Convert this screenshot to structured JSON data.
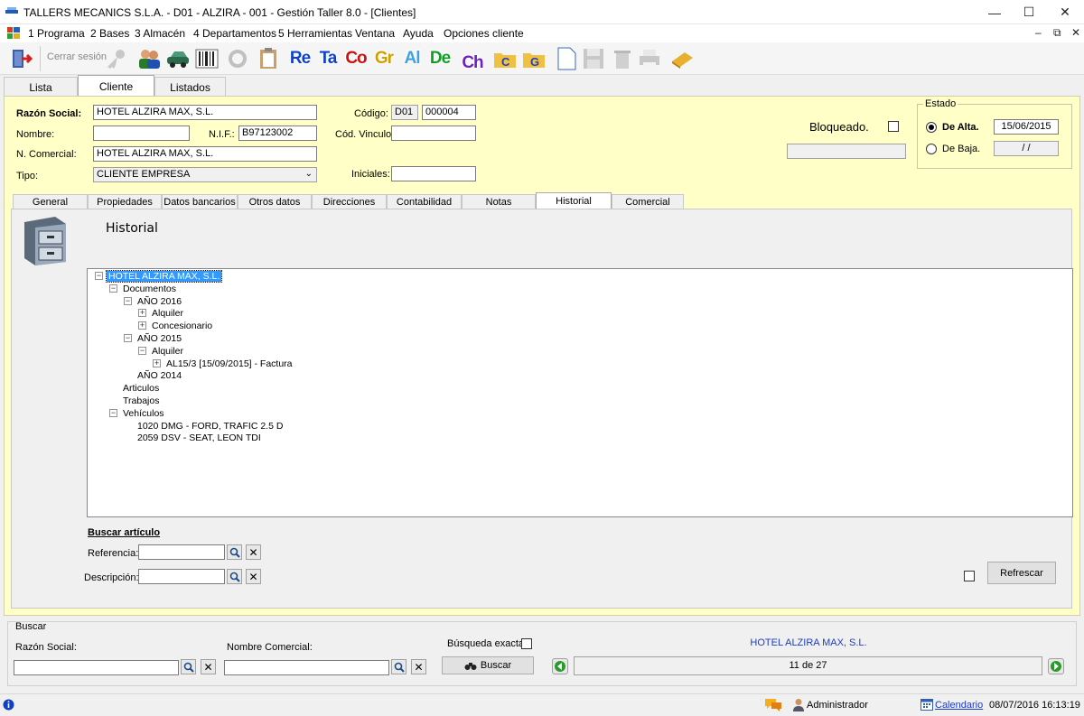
{
  "window": {
    "title": "TALLERS MECANICS S.L.A. - D01 - ALZIRA - 001 - Gestión Taller 8.0 - [Clientes]"
  },
  "menu": [
    "1 Programa",
    "2 Bases",
    "3 Almacén",
    "4 Departamentos",
    "5 Herramientas",
    "Ventana",
    "Ayuda",
    "Opciones cliente"
  ],
  "toolbar": {
    "cerrar_sesion": "Cerrar sesión",
    "letters": [
      {
        "text": "Re",
        "color": "#1040d0"
      },
      {
        "text": "Ta",
        "color": "#1040d0"
      },
      {
        "text": "Co",
        "color": "#d01010"
      },
      {
        "text": "Gr",
        "color": "#d0a000"
      },
      {
        "text": "Al",
        "color": "#40a0e0"
      },
      {
        "text": "De",
        "color": "#10a020"
      },
      {
        "text": "Ch",
        "color": "#7020c0"
      }
    ]
  },
  "tabs": {
    "lista": "Lista",
    "cliente": "Cliente",
    "listados": "Listados"
  },
  "form": {
    "razon_social_label": "Razón Social:",
    "razon_social": "HOTEL ALZIRA MAX, S.L.",
    "nombre_label": "Nombre:",
    "nombre": "",
    "nif_label": "N.I.F.:",
    "nif": "B97123002",
    "n_comercial_label": "N. Comercial:",
    "n_comercial": "HOTEL ALZIRA MAX, S.L.",
    "tipo_label": "Tipo:",
    "tipo": "CLIENTE EMPRESA",
    "codigo_label": "Código:",
    "codigo_prefix": "D01",
    "codigo": "000004",
    "cod_vinculo_label": "Cód. Vinculo",
    "cod_vinculo": "",
    "iniciales_label": "Iniciales:",
    "iniciales": "",
    "bloqueado_label": "Bloqueado.",
    "bloqueado_motivo": ""
  },
  "estado": {
    "legend": "Estado",
    "alta_label": "De Alta.",
    "alta_date": "15/06/2015",
    "baja_label": "De Baja.",
    "baja_date": " / /"
  },
  "subtabs": [
    "General",
    "Propiedades",
    "Datos bancarios",
    "Otros datos",
    "Direcciones",
    "Contabilidad",
    "Notas",
    "Historial",
    "Comercial"
  ],
  "historial": {
    "title": "Historial",
    "tree": [
      {
        "label": "HOTEL ALZIRA MAX, S.L.",
        "level": 0,
        "exp": "−",
        "selected": true
      },
      {
        "label": "Documentos",
        "level": 1,
        "exp": "−"
      },
      {
        "label": "AÑO 2016",
        "level": 2,
        "exp": "−"
      },
      {
        "label": "Alquiler",
        "level": 3,
        "exp": "+"
      },
      {
        "label": "Concesionario",
        "level": 3,
        "exp": "+"
      },
      {
        "label": "AÑO 2015",
        "level": 2,
        "exp": "−"
      },
      {
        "label": "Alquiler",
        "level": 3,
        "exp": "−"
      },
      {
        "label": "AL15/3 [15/09/2015] - Factura",
        "level": 4,
        "exp": "+"
      },
      {
        "label": "AÑO 2014",
        "level": 2,
        "exp": ""
      },
      {
        "label": "Articulos",
        "level": 1,
        "exp": ""
      },
      {
        "label": "Trabajos",
        "level": 1,
        "exp": ""
      },
      {
        "label": "Vehículos",
        "level": 1,
        "exp": "−"
      },
      {
        "label": "1020 DMG - FORD, TRAFIC 2.5 D",
        "level": 2,
        "exp": ""
      },
      {
        "label": "2059 DSV - SEAT, LEON TDI",
        "level": 2,
        "exp": ""
      }
    ],
    "buscar_articulo": "Buscar artículo",
    "referencia_label": "Referencia:",
    "referencia": "",
    "descripcion_label": "Descripción:",
    "descripcion": "",
    "refrescar": "Refrescar"
  },
  "buscar": {
    "legend": "Buscar",
    "razon_social_label": "Razón Social:",
    "razon_social": "",
    "nombre_comercial_label": "Nombre Comercial:",
    "nombre_comercial": "",
    "busqueda_exacta_label": "Búsqueda exacta.",
    "buscar_button": "Buscar",
    "current": "HOTEL ALZIRA MAX, S.L.",
    "position": "11 de 27"
  },
  "status": {
    "user": "Administrador",
    "calendario": "Calendario",
    "datetime": "08/07/2016 16:13:19"
  },
  "colors": {
    "panel_bg": "#ffffc8",
    "selected": "#3399ff",
    "link": "#1a3cc8"
  }
}
